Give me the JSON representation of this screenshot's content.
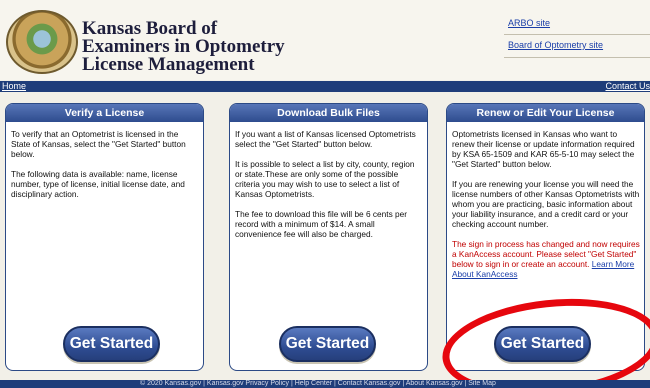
{
  "header": {
    "title_lines": [
      "Kansas Board of",
      "Examiners in Optometry",
      "License Management"
    ],
    "links": [
      "ARBO site",
      "Board of Optometry site"
    ]
  },
  "navbar": {
    "left": "Home",
    "right": "Contact Us"
  },
  "panels": [
    {
      "title": "Verify a License",
      "paragraphs": [
        "To verify that an Optometrist is licensed in the State of Kansas, select the \"Get Started\" button below.",
        "The following data is available: name, license number, type of license, initial license date, and disciplinary action."
      ],
      "button": "Get Started"
    },
    {
      "title": "Download Bulk Files",
      "paragraphs": [
        "If you want a list of Kansas licensed Optometrists select the \"Get Started\" button below.",
        "It is possible to select a list by city, county, region or state.These are only some of the possible criteria you may wish to use to select a list of Kansas Optometrists.",
        "The fee to download this file will be 6 cents per record with a minimum of $14. A small convenience fee will also be charged."
      ],
      "button": "Get Started"
    },
    {
      "title": "Renew or Edit Your License",
      "paragraphs": [
        "Optometrists licensed in Kansas who want to renew their license or update information required by KSA 65-1509 and KAR 65-5-10 may select the \"Get Started\" button below.",
        "If you are renewing your license you will need the license numbers of other Kansas Optometrists with whom you are practicing, basic information about your liability insurance, and a credit card or your checking account number."
      ],
      "notice": "The sign in process has changed and now requires a KanAccess account. Please select \"Get Started\" below to sign in or create an account.",
      "notice_link": "Learn More About KanAccess",
      "button": "Get Started"
    }
  ],
  "footer": {
    "text": "© 2020 Kansas.gov | Kansas.gov Privacy Policy | Help Center | Contact Kansas.gov | About Kansas.gov | Site Map"
  },
  "colors": {
    "nav_bar": "#1f3d7a",
    "panel_header": "#3a5a9e",
    "annotation_circle": "#e6070e",
    "notice_text": "#c00000"
  }
}
